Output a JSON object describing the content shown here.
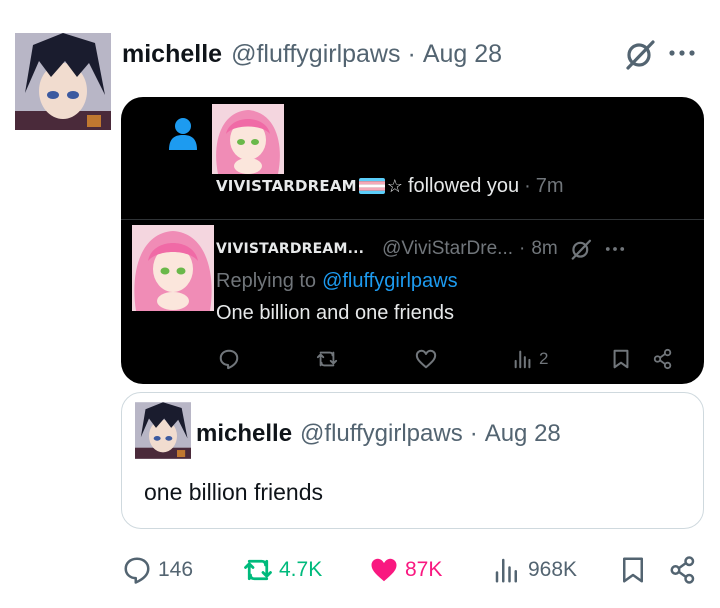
{
  "tweet": {
    "author_name": "michelle",
    "handle": "@fluffygirlpaws",
    "separator": "·",
    "date": "Aug 28",
    "grok_icon": "grok-slash-icon",
    "more_icon": "more-dots-icon"
  },
  "screenshot": {
    "notification": {
      "icon": "person-icon",
      "username": "VIVISTARDREAM",
      "flag": "trans-flag",
      "star": "☆",
      "action": "followed you",
      "separator": "·",
      "time": "7m"
    },
    "reply": {
      "username": "VIVISTARDREAM...",
      "handle": "@ViviStarDre...",
      "separator": "·",
      "time": "8m",
      "replying_label": "Replying to",
      "replying_mention": "@fluffygirlpaws",
      "body": "One billion and one friends",
      "views_count": "2"
    },
    "colors": {
      "background": "#000000",
      "text": "#e7e9ea",
      "muted": "#71767b",
      "link": "#1d9bf0"
    }
  },
  "quote": {
    "author_name": "michelle",
    "handle": "@fluffygirlpaws",
    "separator": "·",
    "date": "Aug 28",
    "body": "one billion friends"
  },
  "actions": {
    "replies": "146",
    "retweets": "4.7K",
    "likes": "87K",
    "views": "968K"
  },
  "colors": {
    "retweet": "#00ba7c",
    "like": "#f91880",
    "muted": "#536471"
  }
}
